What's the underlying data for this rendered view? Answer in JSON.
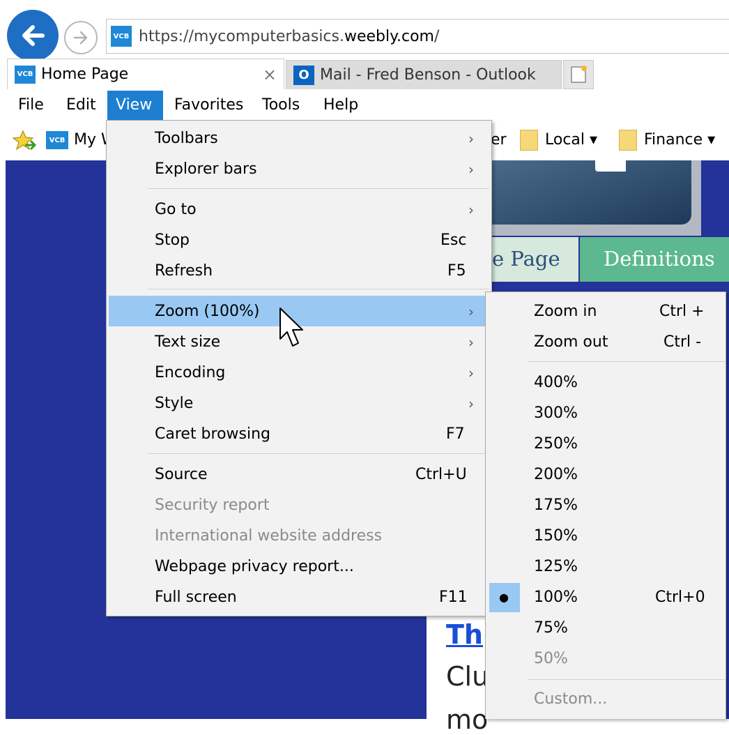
{
  "address_bar": {
    "url_prefix": "https://mycomputerbasics.",
    "url_host": "weebly.com",
    "url_suffix": "/",
    "favicon_text": "VCB"
  },
  "tabs": [
    {
      "label": "Home Page",
      "favicon_text": "VCB",
      "close_glyph": "×"
    },
    {
      "label": "Mail - Fred Benson - Outlook",
      "favicon_text": "O"
    }
  ],
  "menubar": [
    "File",
    "Edit",
    "View",
    "Favorites",
    "Tools",
    "Help"
  ],
  "favorites_bar": {
    "site_partial": "My W",
    "partial_right": "er",
    "folders": [
      {
        "label": "Local ▾"
      },
      {
        "label": "Finance ▾"
      }
    ]
  },
  "page": {
    "nav_home_partial": "e Page",
    "nav_definitions": "Definitions",
    "content_heading_partial": "Th",
    "content_line2_partial": "Clu",
    "content_line3_partial": "mo"
  },
  "view_menu": {
    "items": [
      {
        "label": "Toolbars",
        "shortcut": "",
        "submenu": true,
        "disabled": false
      },
      {
        "label": "Explorer bars",
        "shortcut": "",
        "submenu": true,
        "disabled": false
      },
      {
        "label": "Go to",
        "shortcut": "",
        "submenu": true,
        "disabled": false
      },
      {
        "label": "Stop",
        "shortcut": "Esc",
        "submenu": false,
        "disabled": false
      },
      {
        "label": "Refresh",
        "shortcut": "F5",
        "submenu": false,
        "disabled": false
      },
      {
        "label": "Zoom (100%)",
        "shortcut": "",
        "submenu": true,
        "disabled": false,
        "highlighted": true
      },
      {
        "label": "Text size",
        "shortcut": "",
        "submenu": true,
        "disabled": false
      },
      {
        "label": "Encoding",
        "shortcut": "",
        "submenu": true,
        "disabled": false
      },
      {
        "label": "Style",
        "shortcut": "",
        "submenu": true,
        "disabled": false
      },
      {
        "label": "Caret browsing",
        "shortcut": "F7",
        "submenu": false,
        "disabled": false
      },
      {
        "label": "Source",
        "shortcut": "Ctrl+U",
        "submenu": false,
        "disabled": false
      },
      {
        "label": "Security report",
        "shortcut": "",
        "submenu": false,
        "disabled": true
      },
      {
        "label": "International website address",
        "shortcut": "",
        "submenu": false,
        "disabled": true
      },
      {
        "label": "Webpage privacy report...",
        "shortcut": "",
        "submenu": false,
        "disabled": false
      },
      {
        "label": "Full screen",
        "shortcut": "F11",
        "submenu": false,
        "disabled": false
      }
    ]
  },
  "zoom_menu": {
    "items": [
      {
        "label": "Zoom in",
        "shortcut": "Ctrl +",
        "disabled": false
      },
      {
        "label": "Zoom out",
        "shortcut": "Ctrl -",
        "disabled": false
      },
      {
        "label": "400%",
        "shortcut": "",
        "disabled": false
      },
      {
        "label": "300%",
        "shortcut": "",
        "disabled": false
      },
      {
        "label": "250%",
        "shortcut": "",
        "disabled": false
      },
      {
        "label": "200%",
        "shortcut": "",
        "disabled": false
      },
      {
        "label": "175%",
        "shortcut": "",
        "disabled": false
      },
      {
        "label": "150%",
        "shortcut": "",
        "disabled": false
      },
      {
        "label": "125%",
        "shortcut": "",
        "disabled": false
      },
      {
        "label": "100%",
        "shortcut": "Ctrl+0",
        "disabled": false,
        "checked": true
      },
      {
        "label": "75%",
        "shortcut": "",
        "disabled": false
      },
      {
        "label": "50%",
        "shortcut": "",
        "disabled": true
      },
      {
        "label": "Custom...",
        "shortcut": "",
        "disabled": true
      }
    ],
    "check_glyph": "●"
  },
  "colors": {
    "back_button": "#1e6fc4",
    "menu_highlight": "#99c9f2",
    "view_menu_active": "#1e7fd0",
    "page_background": "#24339a",
    "nav_definitions": "#5cb88e",
    "link_blue": "#1a4ed8"
  }
}
